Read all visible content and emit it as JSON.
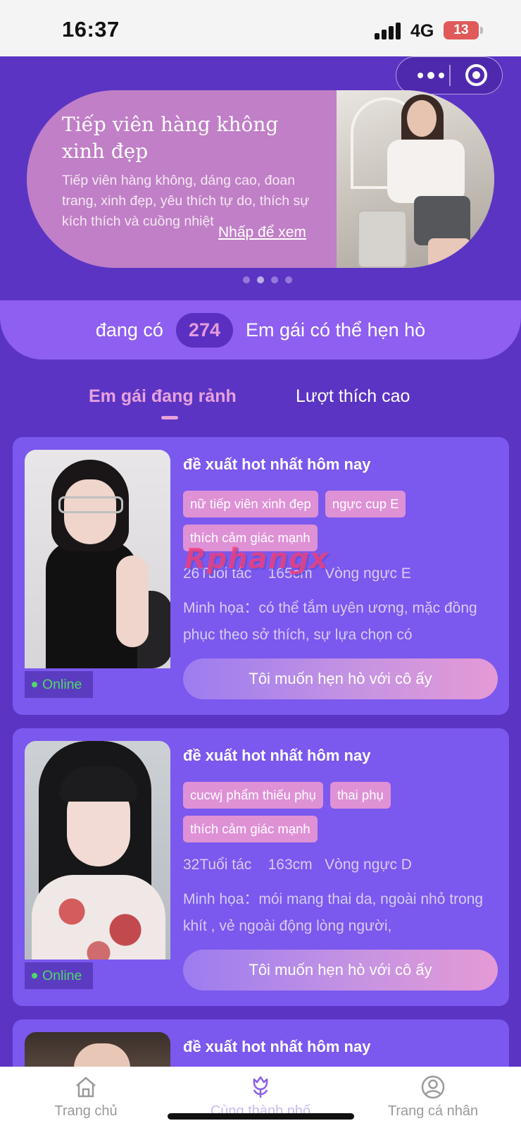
{
  "status_bar": {
    "time": "16:37",
    "network": "4G",
    "battery": "13"
  },
  "banner": {
    "title": "Tiếp viên hàng không xinh đẹp",
    "description": "Tiếp viên hàng không, dáng cao, đoan trang, xinh đẹp, yêu thích tự do, thích sự kích thích và cuồng nhiệt",
    "link_label": "Nhấp để xem",
    "pagination_count": 4,
    "active_page": 2
  },
  "count_bar": {
    "prefix": "đang có",
    "count": "274",
    "suffix": "Em gái có thể hẹn hò"
  },
  "tabs": [
    {
      "label": "Em gái đang rảnh",
      "active": true
    },
    {
      "label": "Lượt thích cao",
      "active": false
    }
  ],
  "cards": [
    {
      "title": "đề xuất hot nhất hôm nay",
      "tags": [
        "nữ tiếp viên xinh đẹp",
        "ngực cup E",
        "thích cảm giác mạnh"
      ],
      "stats": "26Tuổi tác    165cm   Vòng ngực E",
      "description": "Minh họa：có thể tắm uyên ương, mặc đồng phục theo sở thích, sự lựa chọn có",
      "status": "Online",
      "button_label": "Tôi muốn hẹn hò với cô ấy"
    },
    {
      "title": "đề xuất hot nhất hôm nay",
      "tags": [
        "cucwj phẩm thiếu phụ",
        "thai phụ",
        "thích cảm giác mạnh"
      ],
      "stats": "32Tuổi tác    163cm   Vòng ngực D",
      "description": "Minh họa：mói mang thai da, ngoài nhỏ trong khít , vẻ ngoài động lòng người,",
      "status": "Online",
      "button_label": "Tôi muốn hẹn hò với cô ấy"
    },
    {
      "title": "đề xuất hot nhất hôm nay"
    }
  ],
  "watermark": "Rphangx",
  "bottom_nav": [
    {
      "label": "Trang chủ",
      "icon": "home-icon"
    },
    {
      "label": "Cùng thành phố",
      "icon": "flower-icon",
      "active": true
    },
    {
      "label": "Trang cá nhân",
      "icon": "user-icon"
    }
  ],
  "colors": {
    "background": "#5b34c4",
    "card": "#7b58ee",
    "tag": "#df91d6",
    "accent_pink": "#e7a2dc",
    "online_green": "#4ed86a"
  }
}
